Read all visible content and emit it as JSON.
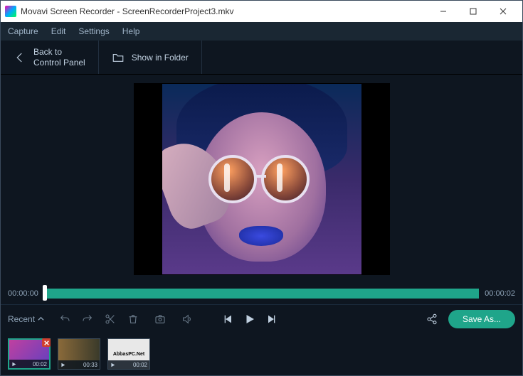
{
  "window": {
    "title": "Movavi Screen Recorder - ScreenRecorderProject3.mkv"
  },
  "menu": {
    "capture": "Capture",
    "edit": "Edit",
    "settings": "Settings",
    "help": "Help"
  },
  "actions": {
    "back_line1": "Back to",
    "back_line2": "Control Panel",
    "show_folder": "Show in Folder"
  },
  "timeline": {
    "start": "00:00:00",
    "end": "00:00:02"
  },
  "toolbar": {
    "recent": "Recent",
    "save": "Save As..."
  },
  "thumbs": [
    {
      "time": "00:02",
      "label": ""
    },
    {
      "time": "00:33",
      "label": ""
    },
    {
      "time": "00:02",
      "label": "AbbasPC.Net"
    }
  ]
}
